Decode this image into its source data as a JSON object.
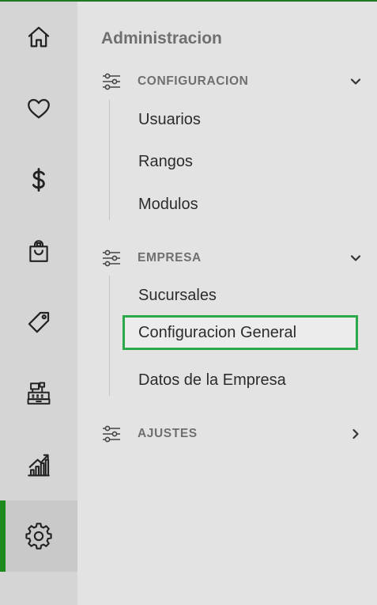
{
  "rail": {
    "items": [
      {
        "icon": "home-icon"
      },
      {
        "icon": "heart-icon"
      },
      {
        "icon": "dollar-icon"
      },
      {
        "icon": "shopping-bag-icon"
      },
      {
        "icon": "tag-icon"
      },
      {
        "icon": "cash-register-icon"
      },
      {
        "icon": "bar-chart-icon"
      },
      {
        "icon": "gear-icon",
        "active": true
      }
    ],
    "accent_color": "#1d8a1d"
  },
  "panel": {
    "title": "Administracion",
    "sections": [
      {
        "label": "CONFIGURACION",
        "icon": "sliders-icon",
        "expanded": true,
        "items": [
          "Usuarios",
          "Rangos",
          "Modulos"
        ]
      },
      {
        "label": "EMPRESA",
        "icon": "sliders-icon",
        "expanded": true,
        "items": [
          "Sucursales",
          "Configuracion General",
          "Datos de la Empresa"
        ],
        "selected": "Configuracion General"
      },
      {
        "label": "AJUSTES",
        "icon": "sliders-icon",
        "expanded": false,
        "items": []
      }
    ],
    "selection_color": "#2aa84a"
  }
}
